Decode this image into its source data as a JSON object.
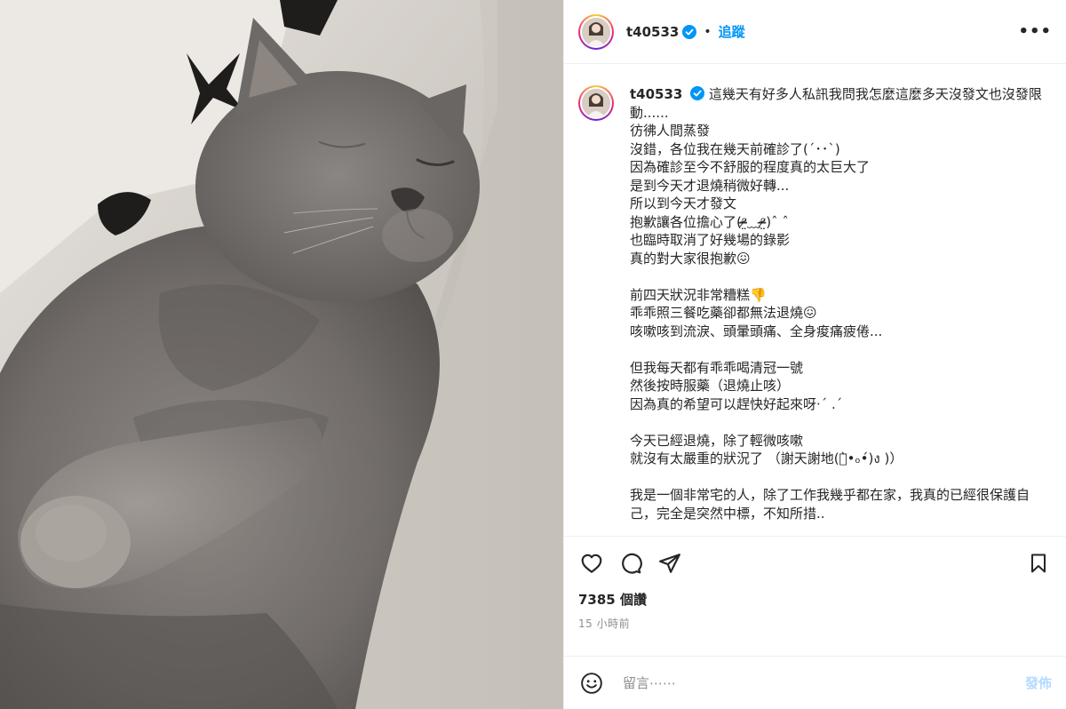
{
  "header": {
    "username": "t40533",
    "separator": "•",
    "follow_label": "追蹤",
    "more_label": "•••"
  },
  "caption": {
    "username": "t40533",
    "text": "這幾天有好多人私訊我問我怎麼這麼多天沒發文也沒發限動......\n彷彿人間蒸發\n沒錯，各位我在幾天前確診了(´･･`)\n因為確診至今不舒服的程度真的太巨大了\n是到今天才退燒稍微好轉...\n所以到今天才發文\n抱歉讓各位擔心了(ᵒ̴̶̷̤﹏ᵒ̴̶̷̤)ˆ ˆ\n也臨時取消了好幾場的錄影\n真的對大家很抱歉😖\n\n前四天狀況非常糟糕👎\n乖乖照三餐吃藥卻都無法退燒😖\n咳嗽咳到流淚、頭暈頭痛、全身痠痛疲倦...\n\n但我每天都有乖乖喝清冠一號\n然後按時服藥（退燒止咳）\n因為真的希望可以趕快好起來呀·ˊ .ˊ\n\n今天已經退燒，除了輕微咳嗽\n就沒有太嚴重的狀況了 （謝天謝地(ง̀•ₒ•́)ง )）\n\n我是一個非常宅的人，除了工作我幾乎都在家，我真的已經很保護自己，完全是突然中標，不知所措..\n\n但一樣，大家還是要好好保護自己"
  },
  "engagement": {
    "likes": "7385 個讚",
    "time": "15 小時前"
  },
  "comment": {
    "placeholder": "留言⋯⋯",
    "post_label": "發佈"
  },
  "icons": [
    "heart-icon",
    "comment-icon",
    "share-icon",
    "bookmark-icon",
    "emoji-icon",
    "verified-icon",
    "more-icon"
  ],
  "colors": {
    "accent": "#0095f6",
    "post_disabled": "#b3dbff",
    "text": "#262626",
    "secondary": "#8e8e8e",
    "border": "#efefef"
  }
}
